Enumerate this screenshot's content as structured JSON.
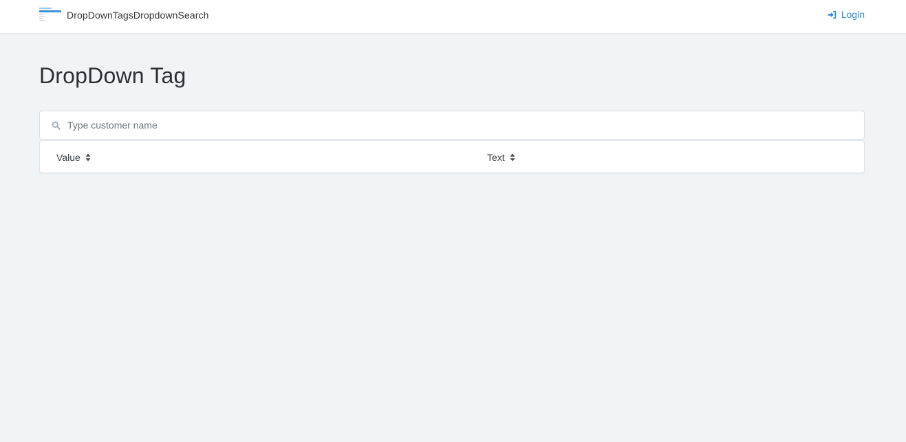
{
  "navbar": {
    "brand_text": "DropDownTagsDropdownSearch",
    "login_label": "Login",
    "accent_color": "#2a8bd8"
  },
  "page": {
    "title": "DropDown Tag"
  },
  "search": {
    "placeholder": "Type customer name",
    "value": ""
  },
  "table": {
    "columns": [
      {
        "label": "Value",
        "sort_icon": "sort-icon"
      },
      {
        "label": "Text",
        "sort_icon": "sort-icon"
      }
    ],
    "rows": []
  }
}
